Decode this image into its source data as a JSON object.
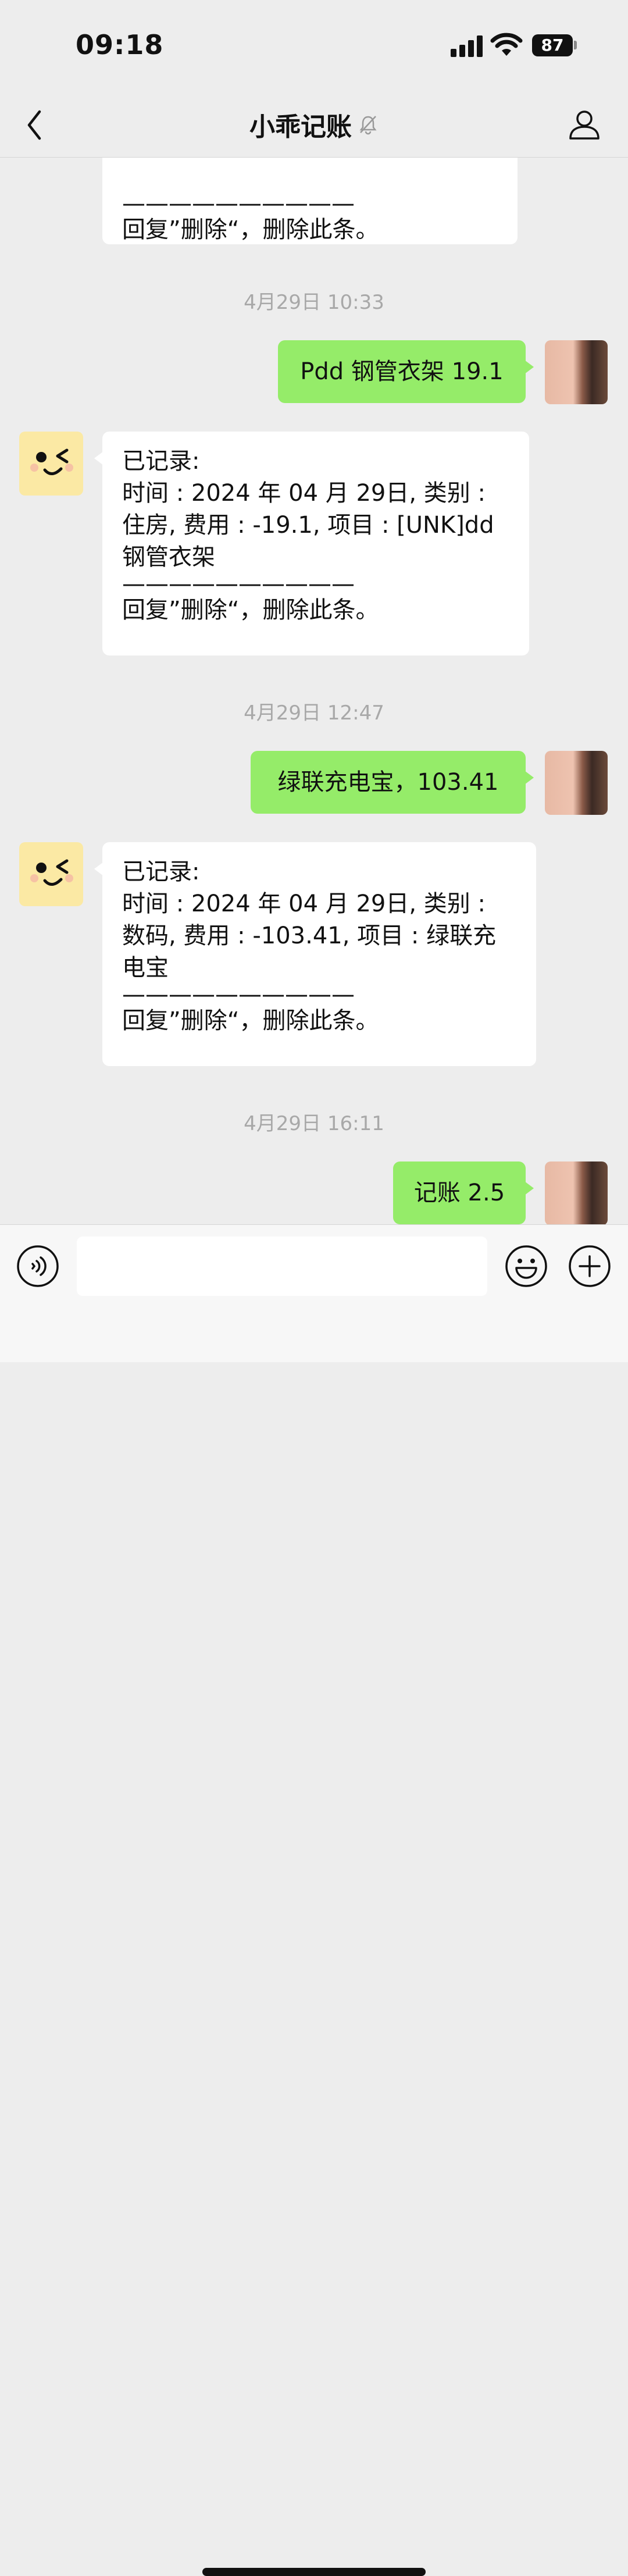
{
  "status_bar": {
    "time": "09:18",
    "battery": "87"
  },
  "header": {
    "title": "小乖记账"
  },
  "messages": {
    "top_partial": {
      "line": "——————————",
      "reply": "回复”删除“，删除此条。"
    },
    "ts1": "4月29日 10:33",
    "user1": "Pdd 钢管衣架 19.1",
    "bot1": {
      "l1": "已记录:",
      "l2": "时间 : 2024 年 04 月 29日, 类别 :",
      "l3": "住房, 费用 : -19.1, 项目 : [UNK]dd",
      "l4": "钢管衣架",
      "line": "——————————",
      "reply": "回复”删除“，删除此条。"
    },
    "ts2": "4月29日 12:47",
    "user2": "绿联充电宝，103.41",
    "bot2": {
      "l1": "已记录:",
      "l2": "时间 : 2024 年 04 月 29日, 类别 :",
      "l3": "数码, 费用 : -103.41, 项目 : 绿联充",
      "l4": "电宝",
      "line": "——————————",
      "reply": "回复”删除“，删除此条。"
    },
    "ts3": "4月29日 16:11",
    "user3": "记账 2.5"
  },
  "input": {
    "value": "",
    "placeholder": ""
  }
}
